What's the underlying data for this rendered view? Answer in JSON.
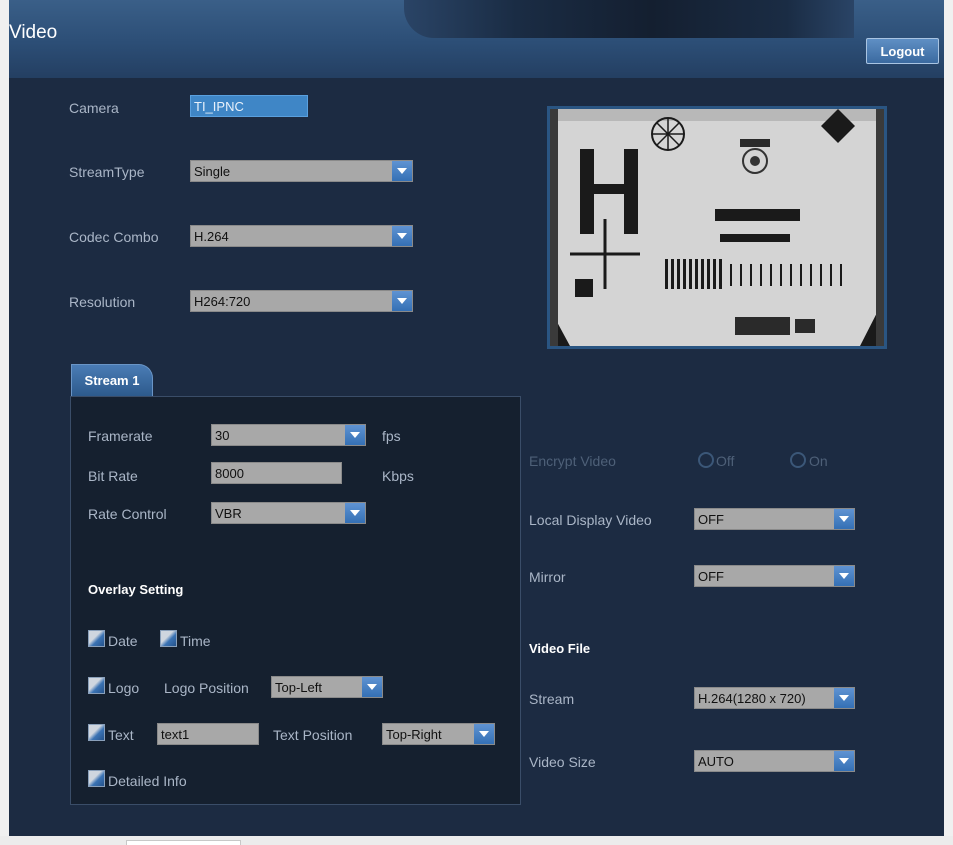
{
  "header": {
    "title": "Video",
    "logout_label": "Logout"
  },
  "camera": {
    "label": "Camera",
    "value": "TI_IPNC"
  },
  "stream_type": {
    "label": "StreamType",
    "value": "Single"
  },
  "codec_combo": {
    "label": "Codec Combo",
    "value": "H.264"
  },
  "resolution": {
    "label": "Resolution",
    "value": "H264:720"
  },
  "stream_tab": {
    "label": "Stream 1"
  },
  "stream": {
    "framerate": {
      "label": "Framerate",
      "value": "30",
      "unit": "fps"
    },
    "bitrate": {
      "label": "Bit Rate",
      "value": "8000",
      "unit": "Kbps"
    },
    "rate_control": {
      "label": "Rate Control",
      "value": "VBR"
    },
    "overlay": {
      "title": "Overlay Setting",
      "date_label": "Date",
      "time_label": "Time",
      "logo_label": "Logo",
      "logo_position_label": "Logo Position",
      "logo_position_value": "Top-Left",
      "text_label": "Text",
      "text_value": "text1",
      "text_position_label": "Text Position",
      "text_position_value": "Top-Right",
      "detailed_info_label": "Detailed Info"
    }
  },
  "encrypt_video": {
    "label": "Encrypt Video",
    "off_label": "Off",
    "on_label": "On"
  },
  "local_display": {
    "label": "Local Display Video",
    "value": "OFF"
  },
  "mirror": {
    "label": "Mirror",
    "value": "OFF"
  },
  "video_file": {
    "title": "Video File",
    "stream_label": "Stream",
    "stream_value": "H.264(1280 x 720)",
    "size_label": "Video Size",
    "size_value": "AUTO"
  },
  "icons": {
    "dropdown": "chevron-down-icon",
    "checkbox": "checkbox-icon",
    "radio": "radio-icon"
  },
  "colors": {
    "background": "#1c2b42",
    "header": "#2c4e76",
    "accent": "#3f86c6",
    "panel": "#15202f"
  }
}
